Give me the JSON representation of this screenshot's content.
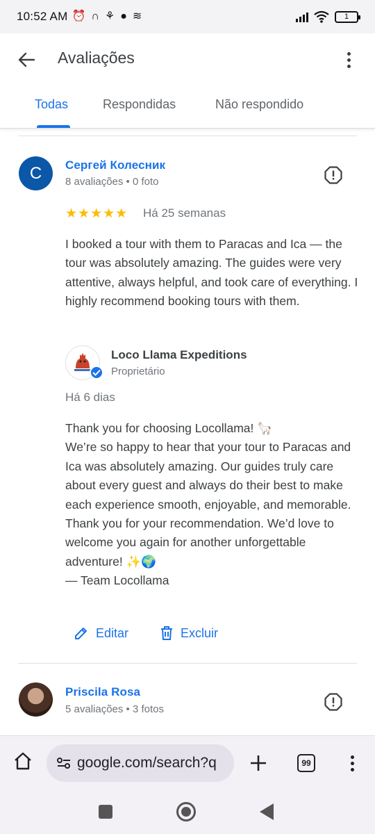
{
  "status_bar": {
    "time": "10:52 AM",
    "battery": "1"
  },
  "app_bar": {
    "title": "Avaliações"
  },
  "tabs": [
    {
      "label": "Todas",
      "active": true
    },
    {
      "label": "Respondidas",
      "active": false
    },
    {
      "label": "Não respondido",
      "active": false
    }
  ],
  "reviews": [
    {
      "avatar_letter": "C",
      "name": "Сергей Колесник",
      "meta": "8 avaliações • 0 foto",
      "rating": 5,
      "stars": "★★★★★",
      "date": "Há 25 semanas",
      "text": "I booked a tour with them to Paracas and Ica — the tour was absolutely amazing. The guides were very attentive, always helpful, and took care of everything. I highly recommend booking tours with them.",
      "reply": {
        "owner_name": "Loco Llama Expeditions",
        "owner_role": "Proprietário",
        "date": "Há 6 dias",
        "text": "Thank you for choosing Locollama! 🦙\nWe’re so happy to hear that your tour to Paracas and Ica was absolutely amazing. Our guides truly care about every guest and always do their best to make each experience smooth, enjoyable, and memorable.\nThank you for your recommendation. We’d love to welcome you again for another unforgettable adventure! ✨🌍\n— Team Locollama"
      },
      "actions": {
        "edit_label": "Editar",
        "delete_label": "Excluir"
      }
    },
    {
      "name": "Priscila Rosa",
      "meta": "5 avaliações • 3 fotos"
    }
  ],
  "browser": {
    "url": "google.com/search?q",
    "tab_count": "99"
  },
  "colors": {
    "accent": "#1a73e8",
    "star": "#fbbc04",
    "avatar_c": "#0b57a8"
  }
}
